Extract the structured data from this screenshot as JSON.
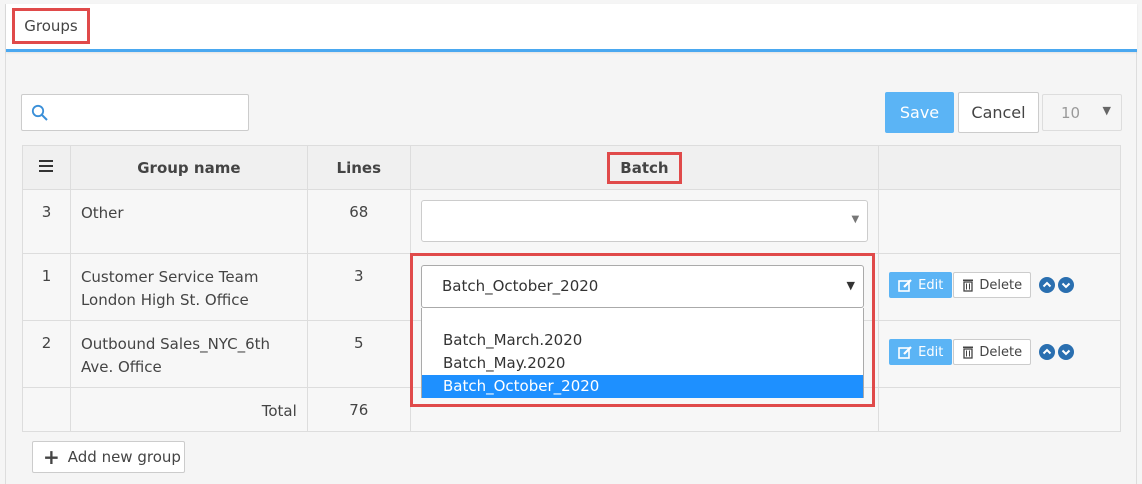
{
  "header": {
    "title": "Groups"
  },
  "toolbar": {
    "search_placeholder": "",
    "save_label": "Save",
    "cancel_label": "Cancel",
    "page_size": "10"
  },
  "table": {
    "headers": {
      "name": "Group name",
      "lines": "Lines",
      "batch": "Batch"
    },
    "rows": [
      {
        "idx": "3",
        "name": "Other",
        "lines": "68"
      },
      {
        "idx": "1",
        "name": "Customer Service Team London High St. Office",
        "lines": "3",
        "batch": "Batch_October_2020"
      },
      {
        "idx": "2",
        "name": "Outbound Sales_NYC_6th Ave. Office",
        "lines": "5"
      }
    ],
    "total_label": "Total",
    "total_value": "76",
    "edit_label": "Edit",
    "delete_label": "Delete"
  },
  "dropdown": {
    "selected": "Batch_October_2020",
    "options": [
      "Batch_March.2020",
      "Batch_May.2020",
      "Batch_October_2020"
    ]
  },
  "footer": {
    "add_label": "Add new group"
  },
  "colors": {
    "accent": "#5bb4f5",
    "highlight": "#e04a4a",
    "selected_option": "#1e90ff"
  }
}
